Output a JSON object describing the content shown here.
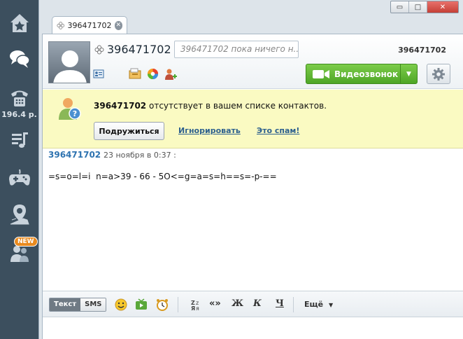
{
  "sidebar": {
    "items": [
      {
        "name": "home",
        "icon": "home-star-icon"
      },
      {
        "name": "chats",
        "icon": "chat-bubbles-icon"
      },
      {
        "name": "calls",
        "icon": "phone-icon",
        "label": "196.4 р."
      },
      {
        "name": "music",
        "icon": "music-list-icon"
      },
      {
        "name": "games",
        "icon": "gamepad-icon"
      },
      {
        "name": "map",
        "icon": "map-pin-icon"
      },
      {
        "name": "people",
        "icon": "people-icon",
        "badge": "NEW"
      }
    ]
  },
  "window": {
    "controls": [
      "▭",
      "□",
      "✕"
    ]
  },
  "tab": {
    "title": "396471702",
    "close": "✕"
  },
  "header": {
    "contact_name": "396471702",
    "status_placeholder": "396471702 пока ничего н...",
    "uin": "396471702",
    "video_button": "Видеозвонок"
  },
  "notice": {
    "contact": "396471702",
    "text": "отсутствует в вашем списке контактов.",
    "add_button": "Подружиться",
    "ignore_link": "Игнорировать",
    "spam_link": "Это спам!"
  },
  "messages": [
    {
      "author": "396471702",
      "time": "23 ноября в 0:37 :",
      "text": "=s=o=l=i  n=a>39 - 66 - 5O<=g=a=s=h==s=-p-=="
    }
  ],
  "toolbar": {
    "mode_text": "Текст",
    "mode_sms": "SMS",
    "translit": "«»",
    "bold": "Ж",
    "italic": "К",
    "underline": "Ч",
    "more": "Ещё"
  },
  "colors": {
    "sidebar": "#3c4f5e",
    "accent_green": "#5cb432",
    "notice_bg": "#fafac2",
    "author_blue": "#2e73b0"
  }
}
